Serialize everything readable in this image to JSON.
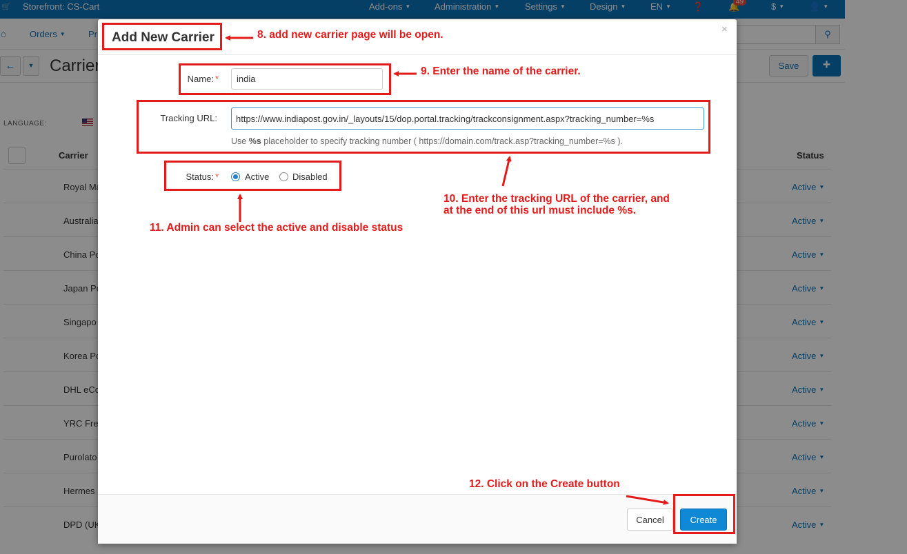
{
  "topbar": {
    "store_label": "Storefront: CS-Cart",
    "menus": [
      "Add-ons",
      "Administration",
      "Settings",
      "Design",
      "EN"
    ],
    "notification_count": "49",
    "currency": "$"
  },
  "toolbar": {
    "orders_label": "Orders",
    "products_label_partial": "Pr"
  },
  "subbar": {
    "page_title_partial": "Carrier",
    "save_label": "Save",
    "add_label": "+"
  },
  "list": {
    "language_label": "LANGUAGE:",
    "header_carrier": "Carrier",
    "header_status": "Status",
    "rows": [
      {
        "name": "Royal Ma",
        "status": "Active"
      },
      {
        "name": "Australia",
        "status": "Active"
      },
      {
        "name": "China Po",
        "status": "Active"
      },
      {
        "name": "Japan Po",
        "status": "Active"
      },
      {
        "name": "Singapo",
        "status": "Active"
      },
      {
        "name": "Korea Po",
        "status": "Active"
      },
      {
        "name": "DHL eCo",
        "status": "Active"
      },
      {
        "name": "YRC Fre",
        "status": "Active"
      },
      {
        "name": "Purolato",
        "status": "Active"
      },
      {
        "name": "Hermes",
        "status": "Active"
      },
      {
        "name": "DPD (UK",
        "status": "Active"
      }
    ]
  },
  "modal": {
    "title": "Add New Carrier",
    "close_glyph": "×",
    "name_label": "Name:",
    "name_value": "india",
    "tracking_label": "Tracking URL:",
    "tracking_value": "https://www.indiapost.gov.in/_layouts/15/dop.portal.tracking/trackconsignment.aspx?tracking_number=%s",
    "help_prefix": "Use",
    "help_bold": "%s",
    "help_suffix": "placeholder to specify tracking number ( https://domain.com/track.asp?tracking_number=%s ).",
    "status_label": "Status:",
    "status_options": [
      "Active",
      "Disabled"
    ],
    "status_selected": "Active",
    "cancel_label": "Cancel",
    "create_label": "Create"
  },
  "annotations": {
    "step8": "8. add new carrier page will be open.",
    "step9": "9. Enter the name of the carrier.",
    "step10_line1": "10. Enter the tracking URL of the carrier, and",
    "step10_line2": "at the end of this url must include %s.",
    "step11": "11. Admin can select the active and disable status",
    "step12": "12. Click on the Create button",
    "color": "#e31b1b"
  }
}
